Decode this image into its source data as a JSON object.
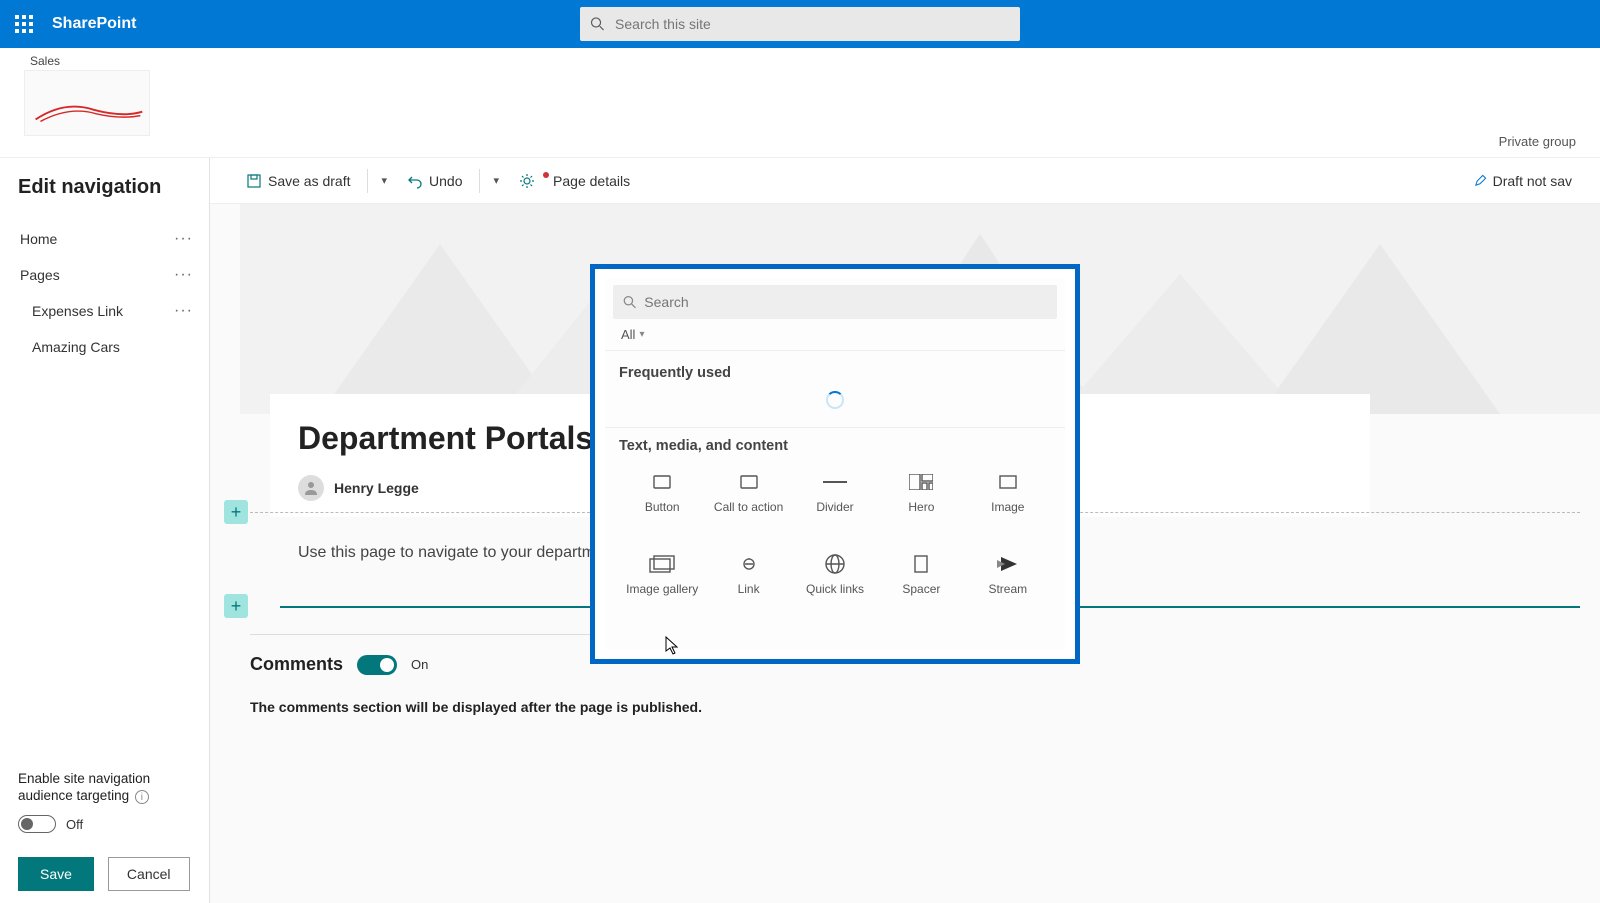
{
  "suite": {
    "app_name": "SharePoint",
    "search_placeholder": "Search this site"
  },
  "site": {
    "name": "Sales",
    "privacy": "Private group"
  },
  "cmd": {
    "save_draft": "Save as draft",
    "undo": "Undo",
    "page_details": "Page details",
    "draft_status": "Draft not sav"
  },
  "nav_panel": {
    "heading": "Edit navigation",
    "items": {
      "home": "Home",
      "pages": "Pages",
      "expenses": "Expenses Link",
      "amazing": "Amazing Cars"
    },
    "targeting_label_a": "Enable site navigation",
    "targeting_label_b": "audience targeting",
    "targeting_state": "Off",
    "save": "Save",
    "cancel": "Cancel"
  },
  "page": {
    "title": "Department Portals",
    "author": "Henry Legge",
    "body_text": "Use this page to navigate to your department portals",
    "comments_heading": "Comments",
    "comments_state": "On",
    "comments_note": "The comments section will be displayed after the page is published."
  },
  "picker": {
    "search_placeholder": "Search",
    "filter": "All",
    "section_freq": "Frequently used",
    "section_text": "Text, media, and content",
    "items": {
      "button": "Button",
      "cta": "Call to action",
      "divider": "Divider",
      "hero": "Hero",
      "image": "Image",
      "gallery": "Image gallery",
      "link": "Link",
      "quick": "Quick links",
      "spacer": "Spacer",
      "stream": "Stream"
    }
  }
}
